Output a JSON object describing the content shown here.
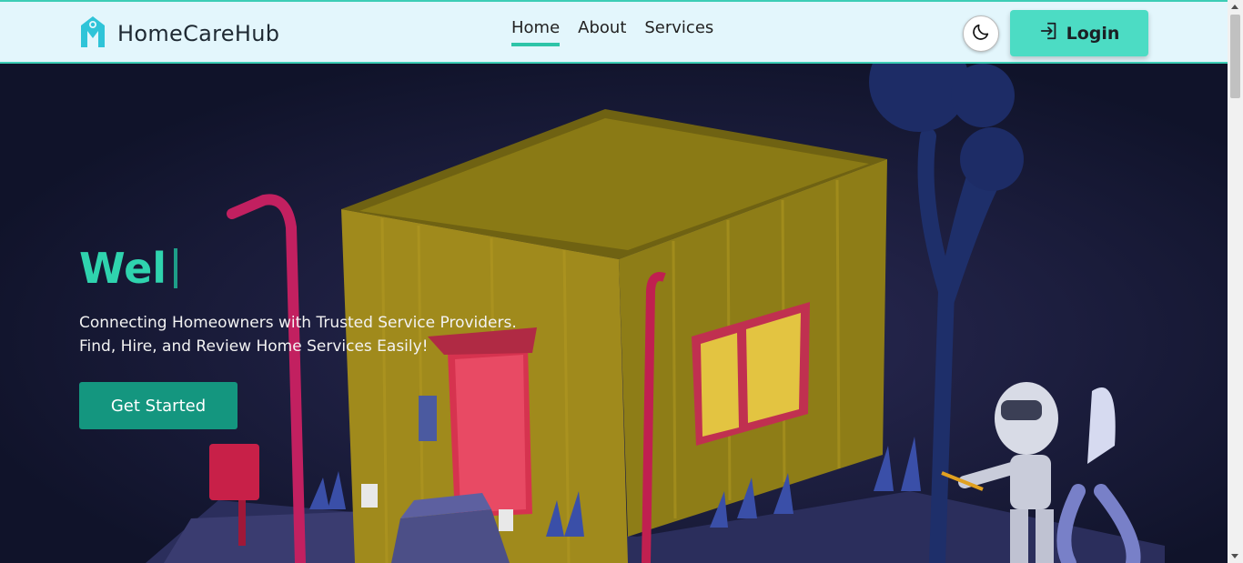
{
  "navbar": {
    "brand": "HomeCareHub",
    "links": [
      {
        "label": "Home",
        "active": true
      },
      {
        "label": "About",
        "active": false
      },
      {
        "label": "Services",
        "active": false
      }
    ],
    "theme_icon": "moon-icon",
    "login_label": "Login",
    "login_icon": "login-icon"
  },
  "hero": {
    "typed_text": "Wel",
    "tagline_line1": "Connecting Homeowners with Trusted Service Providers.",
    "tagline_line2": "Find, Hire, and Review Home Services Easily!",
    "cta_label": "Get Started"
  },
  "colors": {
    "accent": "#4cdcc4",
    "cta": "#14967f",
    "typed": "#2fd3ae",
    "navbar_bg": "#e3f6fc",
    "hero_bg": "#10132a"
  }
}
